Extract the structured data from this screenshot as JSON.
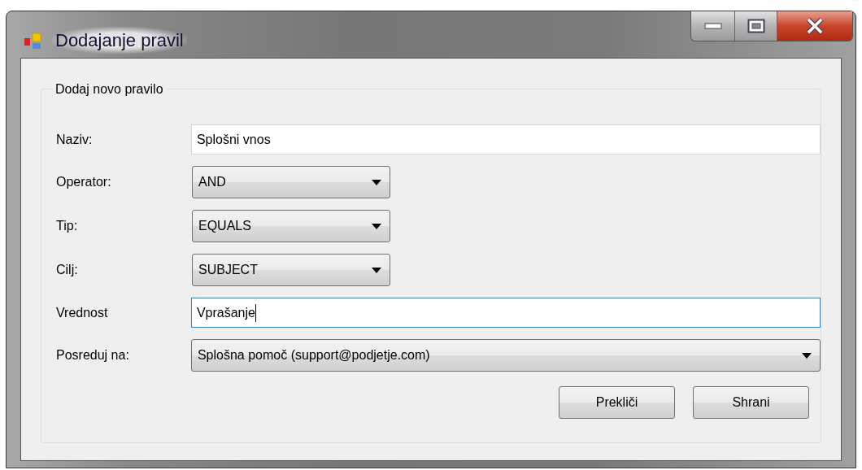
{
  "window": {
    "title": "Dodajanje pravil"
  },
  "group": {
    "title": "Dodaj novo pravilo",
    "fields": [
      {
        "label": "Naziv:",
        "kind": "text",
        "value": "Splošni vnos",
        "focused": false,
        "wide": true
      },
      {
        "label": "Operator:",
        "kind": "combo",
        "value": "AND",
        "focused": false,
        "wide": false
      },
      {
        "label": "Tip:",
        "kind": "combo",
        "value": "EQUALS",
        "focused": false,
        "wide": false
      },
      {
        "label": "Cilj:",
        "kind": "combo",
        "value": "SUBJECT",
        "focused": false,
        "wide": false
      },
      {
        "label": "Vrednost",
        "kind": "text",
        "value": "Vprašanje",
        "focused": true,
        "wide": true
      },
      {
        "label": "Posreduj na:",
        "kind": "combo",
        "value": "Splošna pomoč (support@podjetje.com)",
        "focused": false,
        "wide": true
      }
    ]
  },
  "buttons": [
    "Prekliči",
    "Shrani"
  ]
}
